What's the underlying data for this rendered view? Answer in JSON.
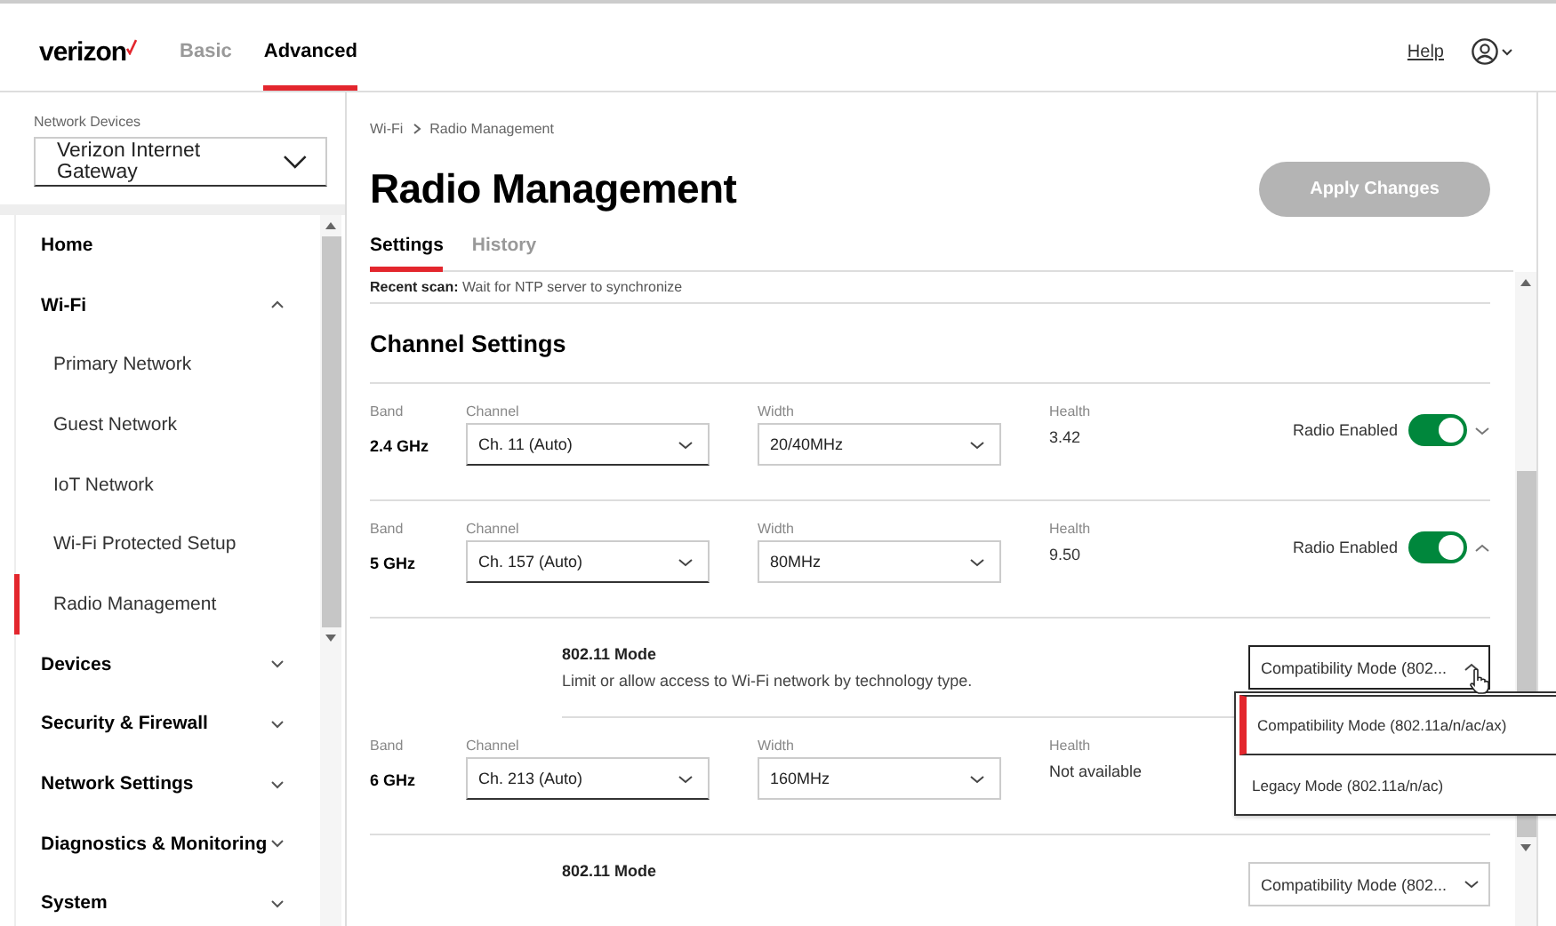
{
  "header": {
    "logo": "verizon",
    "tabs": [
      {
        "label": "Basic",
        "selected": false
      },
      {
        "label": "Advanced",
        "selected": true
      }
    ],
    "help": "Help"
  },
  "sidebar": {
    "device_label": "Network Devices",
    "device": "Verizon Internet Gateway",
    "items": [
      {
        "label": "Home",
        "kind": "section"
      },
      {
        "label": "Wi-Fi",
        "kind": "section",
        "expanded": true,
        "children": [
          {
            "label": "Primary Network",
            "selected": false
          },
          {
            "label": "Guest Network",
            "selected": false
          },
          {
            "label": "IoT Network",
            "selected": false
          },
          {
            "label": "Wi-Fi Protected Setup",
            "selected": false
          },
          {
            "label": "Radio Management",
            "selected": true
          }
        ]
      },
      {
        "label": "Devices",
        "kind": "section",
        "expanded": false
      },
      {
        "label": "Security & Firewall",
        "kind": "section",
        "expanded": false
      },
      {
        "label": "Network Settings",
        "kind": "section",
        "expanded": false
      },
      {
        "label": "Diagnostics & Monitoring",
        "kind": "section",
        "expanded": false
      },
      {
        "label": "System",
        "kind": "section",
        "expanded": false
      }
    ]
  },
  "breadcrumb": [
    "Wi-Fi",
    "Radio Management"
  ],
  "title": "Radio Management",
  "apply_button": {
    "label": "Apply Changes",
    "disabled": true
  },
  "page_tabs": [
    {
      "label": "Settings",
      "selected": true
    },
    {
      "label": "History",
      "selected": false
    }
  ],
  "recent_scan": "**Recent scan:** Wait for NTP server to synchronize",
  "section_title": "Channel Settings",
  "rows": [
    {
      "kind": "band",
      "band_label": "Band",
      "band": "2.4 GHz",
      "channel_label": "Channel",
      "channel": "Ch. 11 (Auto)",
      "width_label": "Width",
      "width": "20/40MHz",
      "health_label": "Health",
      "health": "3.42",
      "radio_label": "Radio Enabled",
      "radio_on": true,
      "expanded": false
    },
    {
      "kind": "band",
      "band_label": "Band",
      "band": "5 GHz",
      "channel_label": "Channel",
      "channel": "Ch. 157 (Auto)",
      "width_label": "Width",
      "width": "80MHz",
      "health_label": "Health",
      "health": "9.50",
      "radio_label": "Radio Enabled",
      "radio_on": true,
      "expanded": true
    },
    {
      "kind": "mode",
      "title": "802.11 Mode",
      "description": "Limit or allow access to Wi-Fi network by technology type.",
      "value": "Compatibility Mode (802...",
      "open": true,
      "options": [
        {
          "label": "Compatibility Mode (802.11a/n/ac/ax)",
          "selected": true
        },
        {
          "label": "Legacy Mode (802.11a/n/ac)",
          "selected": false
        }
      ]
    },
    {
      "kind": "band",
      "band_label": "Band",
      "band": "6 GHz",
      "channel_label": "Channel",
      "channel": "Ch. 213 (Auto)",
      "width_label": "Width",
      "width": "160MHz",
      "health_label": "Health",
      "health": "Not available"
    },
    {
      "kind": "mode",
      "title": "802.11 Mode",
      "value": "Compatibility Mode (802...",
      "open": false
    }
  ]
}
